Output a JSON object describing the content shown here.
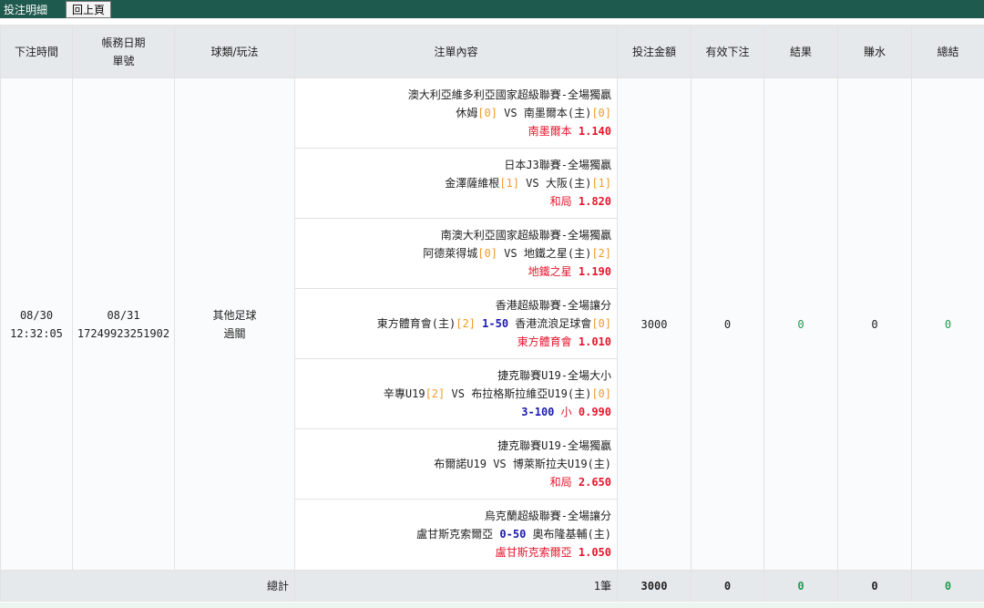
{
  "topbar": {
    "title": "投注明細",
    "back_label": "回上頁"
  },
  "headers": {
    "time": "下注時間",
    "date_line1": "帳務日期",
    "date_line2": "單號",
    "sport": "球類/玩法",
    "content": "注單內容",
    "stake": "投注金額",
    "valid": "有效下注",
    "result": "結果",
    "winloss": "賺水",
    "total": "總結"
  },
  "row": {
    "bet_date": "08/30",
    "bet_time": "12:32:05",
    "account_date": "08/31",
    "order_no": "17249923251902",
    "sport": "其他足球",
    "play": "過關",
    "stake": "3000",
    "valid": "0",
    "result": "0",
    "winloss": "0",
    "total": "0"
  },
  "bets": [
    {
      "league": "澳大利亞維多利亞國家超級聯賽-全場獨贏",
      "home": "休姆",
      "home_score": "[0]",
      "mid": "VS",
      "away": "南墨爾本(主)",
      "away_score": "[0]",
      "handicap": "",
      "selection": "南墨爾本",
      "odds": "1.140"
    },
    {
      "league": "日本J3聯賽-全場獨贏",
      "home": "金澤薩維根",
      "home_score": "[1]",
      "mid": "VS",
      "away": "大阪(主)",
      "away_score": "[1]",
      "handicap": "",
      "selection": "和局",
      "odds": "1.820"
    },
    {
      "league": "南澳大利亞國家超級聯賽-全場獨贏",
      "home": "阿德萊得城",
      "home_score": "[0]",
      "mid": "VS",
      "away": "地鐵之星(主)",
      "away_score": "[2]",
      "handicap": "",
      "selection": "地鐵之星",
      "odds": "1.190"
    },
    {
      "league": "香港超級聯賽-全場讓分",
      "home": "東方體育會(主)",
      "home_score": "[2]",
      "mid": "1-50",
      "away": "香港流浪足球會",
      "away_score": "[0]",
      "handicap": "",
      "selection": "東方體育會",
      "odds": "1.010"
    },
    {
      "league": "捷克聯賽U19-全場大小",
      "home": "辛專U19",
      "home_score": "[2]",
      "mid": "VS",
      "away": "布拉格斯拉維亞U19(主)",
      "away_score": "[0]",
      "handicap": "3-100",
      "selection": "小",
      "odds": "0.990"
    },
    {
      "league": "捷克聯賽U19-全場獨贏",
      "home": "布爾諾U19",
      "home_score": "",
      "mid": "VS",
      "away": "博萊斯拉夫U19(主)",
      "away_score": "",
      "handicap": "",
      "selection": "和局",
      "odds": "2.650"
    },
    {
      "league": "烏克蘭超級聯賽-全場讓分",
      "home": "盧甘斯克索爾亞",
      "home_score": "",
      "mid": "0-50",
      "away": "奧布隆基輔(主)",
      "away_score": "",
      "handicap": "",
      "selection": "盧甘斯克索爾亞",
      "odds": "1.050"
    }
  ],
  "footer": {
    "label": "總計",
    "count": "1筆",
    "stake": "3000",
    "valid": "0",
    "result": "0",
    "winloss": "0",
    "total": "0"
  },
  "colors": {
    "header_bar": "#1f5a4e",
    "score": "#f19b2c",
    "handicap": "#1a1ab0",
    "selection": "#e6162d",
    "positive": "#1f9c4e"
  }
}
